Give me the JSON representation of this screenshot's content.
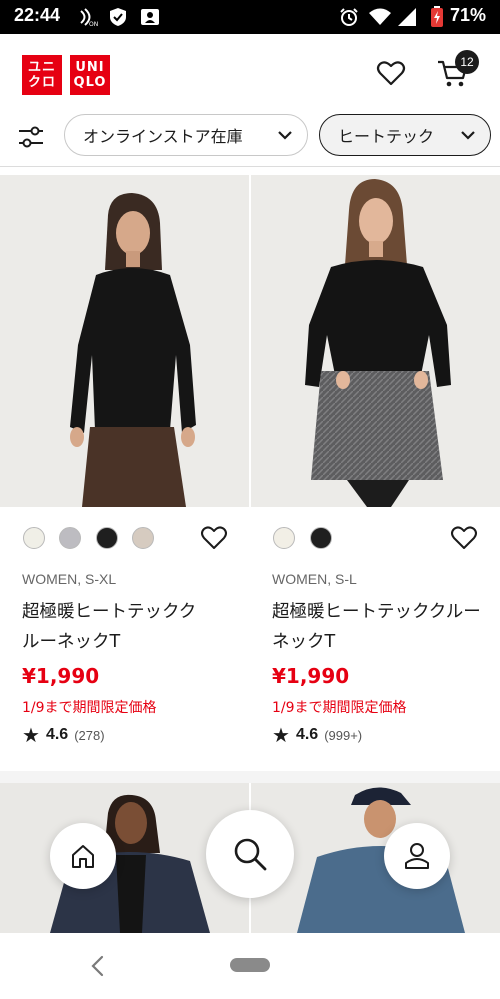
{
  "status_bar": {
    "time": "22:44",
    "battery": "71%",
    "icons": [
      "nfc-icon",
      "shield-icon",
      "contact-card-icon",
      "alarm-icon",
      "wifi-icon",
      "signal-icon",
      "battery-icon"
    ]
  },
  "header": {
    "logo_top": "ユニ\nクロ",
    "logo_right": "UNI\nQLO",
    "cart_count": "12",
    "brand_color": "#e60012"
  },
  "filters": {
    "store_chip": "オンラインストア在庫",
    "category_chip": "ヒートテック"
  },
  "products": [
    {
      "gender_size": "WOMEN, S-XL",
      "name_line1": "超極暖ヒートテックク",
      "name_line2": "ルーネックT",
      "price": "¥1,990",
      "promo": "1/9まで期間限定価格",
      "rating": "4.6",
      "review_count": "(278)",
      "swatches": [
        "#f0efe7",
        "#bdbcc1",
        "#1f1f1f",
        "#d6cbc0"
      ]
    },
    {
      "gender_size": "WOMEN, S-L",
      "name_line1": "超極暖ヒートテッククルーネックT",
      "name_line2": "",
      "price": "¥1,990",
      "promo": "1/9まで期間限定価格",
      "rating": "4.6",
      "review_count": "(999+)",
      "swatches": [
        "#f2efe6",
        "#1f1f1f"
      ]
    }
  ],
  "bottom_nav": {
    "items": [
      "home-icon",
      "search-icon",
      "account-icon"
    ]
  }
}
